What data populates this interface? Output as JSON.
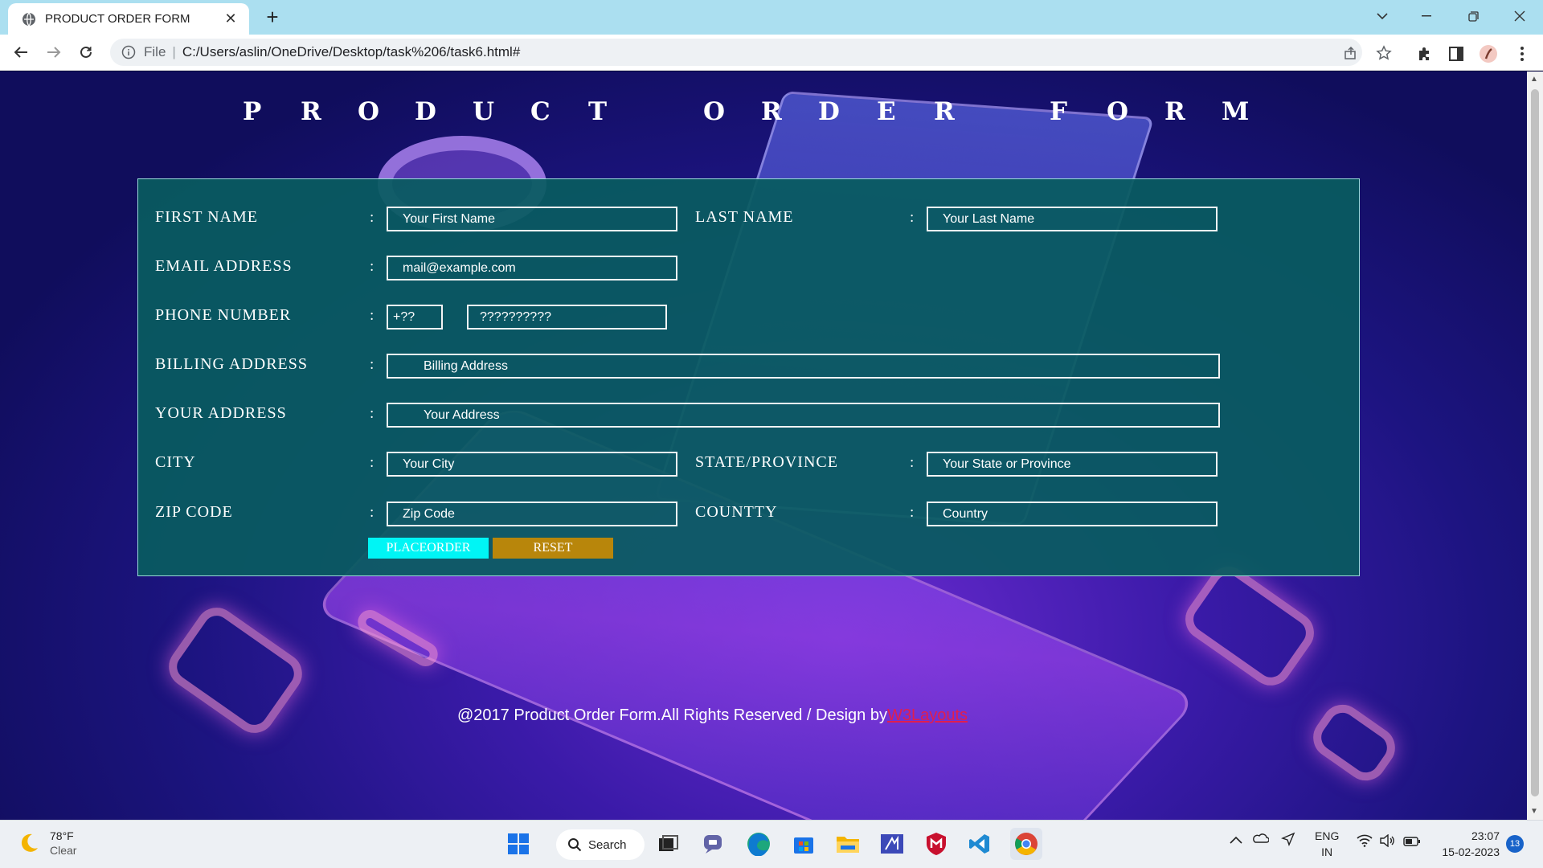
{
  "browser": {
    "tab_title": "PRODUCT ORDER FORM",
    "address_scheme": "File",
    "address_url": "C:/Users/aslin/OneDrive/Desktop/task%206/task6.html#"
  },
  "page": {
    "heading_letters": [
      "P",
      "R",
      "O",
      "D",
      "U",
      "C",
      "T",
      "",
      "O",
      "R",
      "D",
      "E",
      "R",
      "",
      "F",
      "O",
      "R",
      "M"
    ],
    "form": {
      "first_name_label": "FIRST NAME",
      "first_name_placeholder": "Your First Name",
      "last_name_label": "LAST NAME",
      "last_name_placeholder": "Your Last Name",
      "email_label": "EMAIL ADDRESS",
      "email_placeholder": "mail@example.com",
      "phone_label": "PHONE NUMBER",
      "phone_code_placeholder": "+??",
      "phone_number_placeholder": "??????????",
      "billing_label": "BILLING ADDRESS",
      "billing_placeholder": "Billing Address",
      "address_label": "YOUR ADDRESS",
      "address_placeholder": "Your Address",
      "city_label": "CITY",
      "city_placeholder": "Your City",
      "state_label": "STATE/PROVINCE",
      "state_placeholder": "Your State or Province",
      "zip_label": "ZIP CODE",
      "zip_placeholder": "Zip Code",
      "country_label": "COUNTTY",
      "country_placeholder": "Country",
      "colon": ":",
      "place_order_label": "PLACEORDER",
      "reset_label": "RESET"
    },
    "footer": {
      "text": "@2017 Product Order Form.All Rights Reserved / Design by",
      "link": "W3Layouts"
    }
  },
  "taskbar": {
    "weather_temp": "78°F",
    "weather_desc": "Clear",
    "search_label": "Search",
    "lang_top": "ENG",
    "lang_bottom": "IN",
    "time": "23:07",
    "date": "15-02-2023",
    "notification_count": "13"
  },
  "colors": {
    "form_panel": "#095b60",
    "place_order_button": "#00f5f5",
    "reset_button": "#b8860b",
    "footer_link": "#e01e4f",
    "tab_bar": "#abdff0"
  }
}
